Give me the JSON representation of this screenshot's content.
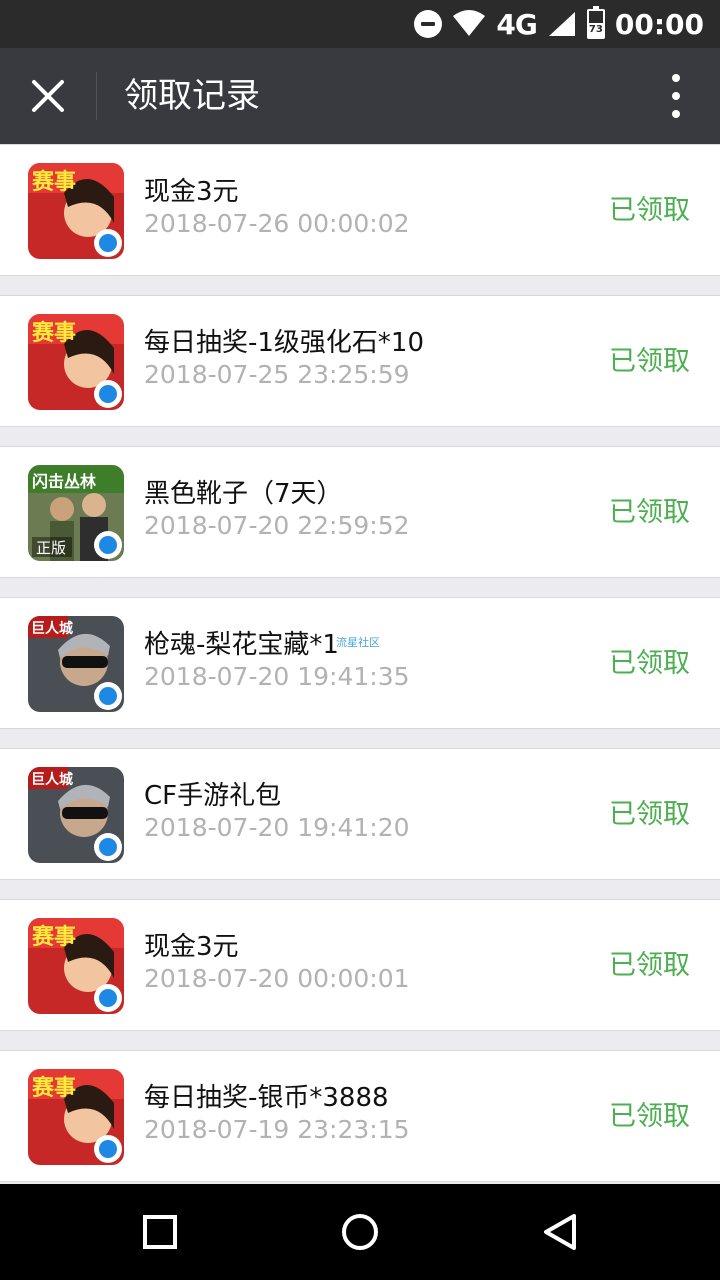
{
  "status_bar": {
    "network": "4G",
    "battery": "73",
    "time": "00:00"
  },
  "nav": {
    "title": "领取记录"
  },
  "records": [
    {
      "name": "现金3元",
      "date": "2018-07-26 00:00:02",
      "status": "已领取",
      "game": "赛事"
    },
    {
      "name": "每日抽奖-1级强化石*10",
      "date": "2018-07-25 23:25:59",
      "status": "已领取",
      "game": "赛事"
    },
    {
      "name": "黑色靴子（7天）",
      "date": "2018-07-20 22:59:52",
      "status": "已领取",
      "game": "闪击丛林 正版"
    },
    {
      "name": "枪魂-梨花宝藏*1",
      "date": "2018-07-20 19:41:35",
      "status": "已领取",
      "game": "巨人城"
    },
    {
      "name": "CF手游礼包",
      "date": "2018-07-20 19:41:20",
      "status": "已领取",
      "game": "巨人城"
    },
    {
      "name": "现金3元",
      "date": "2018-07-20 00:00:01",
      "status": "已领取",
      "game": "赛事"
    },
    {
      "name": "每日抽奖-银币*3888",
      "date": "2018-07-19 23:23:15",
      "status": "已领取",
      "game": "赛事"
    }
  ],
  "watermark": "流星社区",
  "colors": {
    "status": "#4caf50",
    "navbar": "#393a3f",
    "statusbar": "#2b2b2b"
  }
}
